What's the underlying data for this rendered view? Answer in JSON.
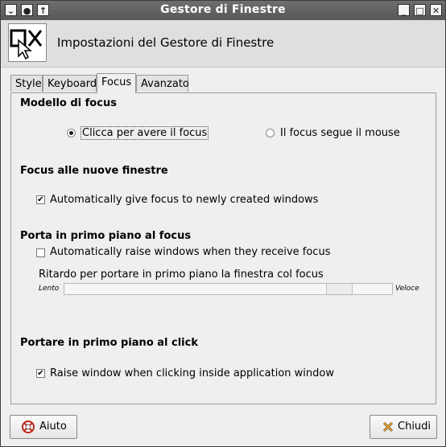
{
  "window": {
    "title": "Gestore di Finestre"
  },
  "header": {
    "title": "Impostazioni del Gestore di Finestre"
  },
  "tabs": [
    "Style",
    "Keyboard",
    "Focus",
    "Avanzato"
  ],
  "active_tab": "Focus",
  "focus_model": {
    "title": "Modello di focus",
    "option_click": "Clicca per avere il focus",
    "option_follow": "Il focus segue il mouse",
    "selected": "option_click"
  },
  "new_windows": {
    "title": "Focus alle nuove finestre",
    "auto_focus_label": "Automatically give focus to newly created windows",
    "auto_focus_checked": true
  },
  "raise_on_focus": {
    "title": "Porta in primo piano al focus",
    "auto_raise_label": "Automatically raise windows when they receive focus",
    "auto_raise_checked": false,
    "delay_label": "Ritardo per portare in primo piano la finestra col focus",
    "slow_label": "Lento",
    "fast_label": "Veloce",
    "delay_fraction": 0.87
  },
  "raise_on_click": {
    "title": "Portare in primo piano al click",
    "raise_click_label": "Raise window when clicking inside application window",
    "raise_click_checked": true
  },
  "buttons": {
    "help": "Aiuto",
    "close": "Chiudi"
  },
  "colors": {
    "titlebar": "#636363",
    "background": "#efefef",
    "header": "#dfdfdf"
  }
}
